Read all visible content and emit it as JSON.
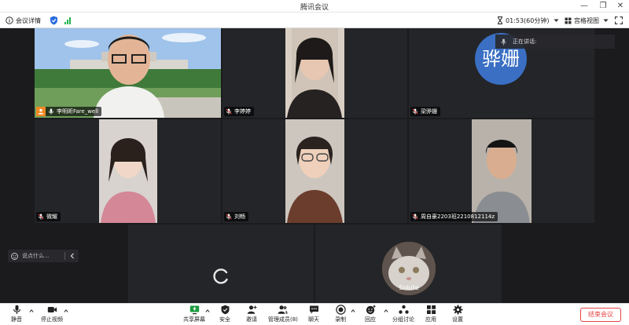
{
  "window": {
    "title": "腾讯会议",
    "controls": {
      "minimize": "—",
      "restore": "❐",
      "close": "✕"
    }
  },
  "infobar": {
    "details_label": "会议详情",
    "timer": "01:53(60分钟)",
    "view_label": "宫格视图"
  },
  "speaking": {
    "label": "正在讲话:"
  },
  "participants": [
    {
      "name": "李明昕Fare_well",
      "host": true
    },
    {
      "name": "李婷婷"
    },
    {
      "name": "梁骅姗",
      "avatar_text": "骅姗",
      "avatar_color": "#3a6fc4"
    },
    {
      "name": "微耀"
    },
    {
      "name": "刘畅"
    },
    {
      "name": "周自豪2203班2210812114z"
    },
    {
      "name": "Solute"
    }
  ],
  "chat": {
    "placeholder": "说点什么..."
  },
  "toolbar": {
    "mute": "静音",
    "stop_video": "停止视频",
    "share_screen": "共享屏幕",
    "security": "安全",
    "invite": "邀请",
    "manage_members": "管理成员(8)",
    "chat": "聊天",
    "record": "录制",
    "reactions": "回应",
    "breakout": "分组讨论",
    "apps": "应用",
    "settings": "设置",
    "end_meeting": "结束会议"
  },
  "colors": {
    "accent_green": "#21b14b",
    "end_red": "#e54545",
    "host_orange": "#f08a24"
  }
}
